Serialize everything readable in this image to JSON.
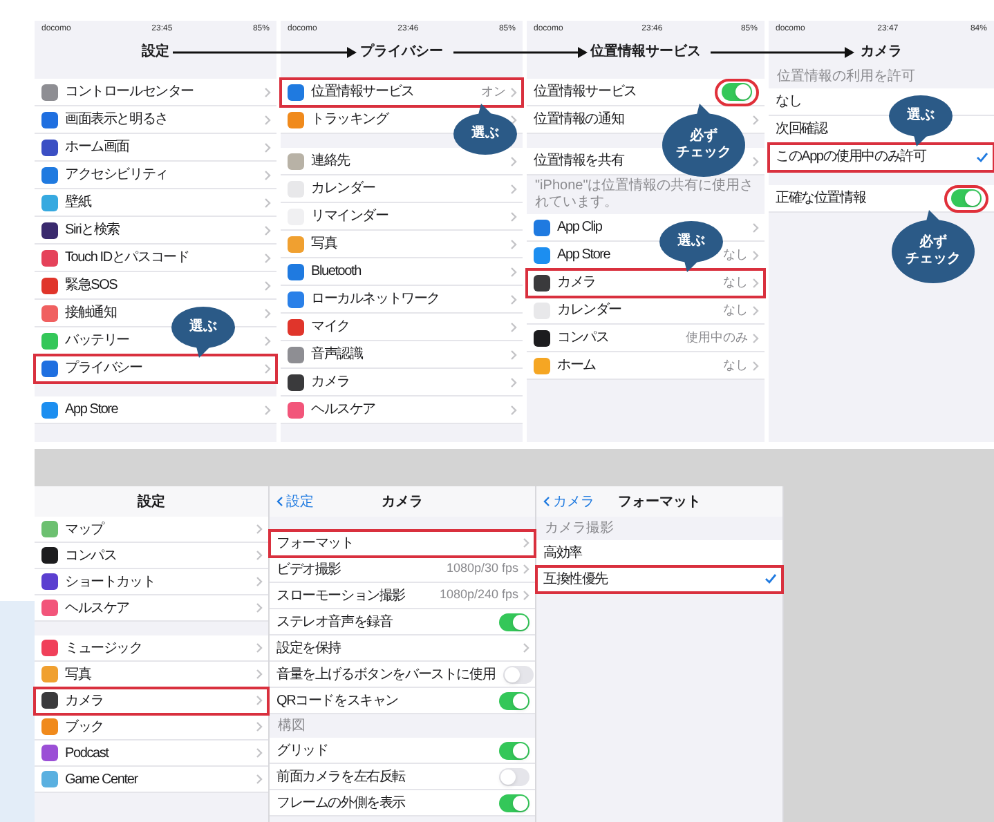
{
  "top_screens": [
    {
      "carrier": "docomo",
      "time": "23:45",
      "battery": "85%",
      "title": "設定",
      "rows": [
        {
          "kind": "gap"
        },
        {
          "kind": "nav",
          "label": "コントロールセンター",
          "color": "#8e8e93"
        },
        {
          "kind": "nav",
          "label": "画面表示と明るさ",
          "color": "#1f6fe0"
        },
        {
          "kind": "nav",
          "label": "ホーム画面",
          "color": "#3b4fc4"
        },
        {
          "kind": "nav",
          "label": "アクセシビリティ",
          "color": "#1f7ae0"
        },
        {
          "kind": "nav",
          "label": "壁紙",
          "color": "#36a9e0"
        },
        {
          "kind": "nav",
          "label": "Siriと検索",
          "color": "#3a2a6e"
        },
        {
          "kind": "nav",
          "label": "Touch IDとパスコード",
          "color": "#e5425a"
        },
        {
          "kind": "nav",
          "label": "緊急SOS",
          "color": "#e0352b"
        },
        {
          "kind": "nav",
          "label": "接触通知",
          "color": "#f06060"
        },
        {
          "kind": "nav",
          "label": "バッテリー",
          "color": "#34c759"
        },
        {
          "kind": "nav",
          "label": "プライバシー",
          "color": "#1f6fe0",
          "highlighted": true,
          "callout": {
            "lines": [
              "選ぶ"
            ]
          }
        },
        {
          "kind": "gap"
        },
        {
          "kind": "nav",
          "label": "App Store",
          "color": "#1c8ef0"
        }
      ]
    },
    {
      "carrier": "docomo",
      "time": "23:46",
      "battery": "85%",
      "title": "プライバシー",
      "rows": [
        {
          "kind": "gap"
        },
        {
          "kind": "nav",
          "label": "位置情報サービス",
          "value": "オン",
          "color": "#1f7ae0",
          "highlighted": true,
          "callout": {
            "lines": [
              "選ぶ"
            ]
          }
        },
        {
          "kind": "nav",
          "label": "トラッキング",
          "color": "#f08a1c"
        },
        {
          "kind": "gap"
        },
        {
          "kind": "nav",
          "label": "連絡先",
          "color": "#b8b2a6"
        },
        {
          "kind": "nav",
          "label": "カレンダー",
          "color": "#e8e8ea"
        },
        {
          "kind": "nav",
          "label": "リマインダー",
          "color": "#f0f0f2"
        },
        {
          "kind": "nav",
          "label": "写真",
          "color": "#f0a030"
        },
        {
          "kind": "nav",
          "label": "Bluetooth",
          "color": "#1f7ae0"
        },
        {
          "kind": "nav",
          "label": "ローカルネットワーク",
          "color": "#2a80e8"
        },
        {
          "kind": "nav",
          "label": "マイク",
          "color": "#e0352b"
        },
        {
          "kind": "nav",
          "label": "音声認識",
          "color": "#8e8e93"
        },
        {
          "kind": "nav",
          "label": "カメラ",
          "color": "#3a3a3c"
        },
        {
          "kind": "nav",
          "label": "ヘルスケア",
          "color": "#f2557a"
        }
      ]
    },
    {
      "carrier": "docomo",
      "time": "23:46",
      "battery": "85%",
      "title": "位置情報サービス",
      "rows": [
        {
          "kind": "gap"
        },
        {
          "kind": "toggle",
          "label": "位置情報サービス",
          "on": true,
          "circled": true,
          "callout": {
            "lines": [
              "必ず",
              "チェック"
            ]
          }
        },
        {
          "kind": "nav",
          "label": "位置情報の通知"
        },
        {
          "kind": "gap"
        },
        {
          "kind": "nav",
          "label": "位置情報を共有"
        },
        {
          "kind": "note",
          "text": "\"iPhone\"は位置情報の共有に使用されています。"
        },
        {
          "kind": "nav",
          "label": "App Clip",
          "color": "#1f7ae0"
        },
        {
          "kind": "nav",
          "label": "App Store",
          "value": "なし",
          "color": "#1c8ef0"
        },
        {
          "kind": "nav",
          "label": "カメラ",
          "value": "なし",
          "color": "#3a3a3c",
          "highlighted": true,
          "callout": {
            "lines": [
              "選ぶ"
            ]
          }
        },
        {
          "kind": "nav",
          "label": "カレンダー",
          "value": "なし",
          "color": "#e8e8ea"
        },
        {
          "kind": "nav",
          "label": "コンパス",
          "value": "使用中のみ",
          "color": "#1c1c1e"
        },
        {
          "kind": "nav",
          "label": "ホーム",
          "value": "なし",
          "color": "#f5a623"
        }
      ]
    },
    {
      "carrier": "docomo",
      "time": "23:47",
      "battery": "84%",
      "title": "カメラ",
      "rows": [
        {
          "kind": "header",
          "text": "位置情報の利用を許可"
        },
        {
          "kind": "check",
          "label": "なし",
          "checked": false
        },
        {
          "kind": "check",
          "label": "次回確認",
          "checked": false
        },
        {
          "kind": "check",
          "label": "このAppの使用中のみ許可",
          "checked": true,
          "highlighted": true,
          "callout": {
            "lines": [
              "選ぶ"
            ]
          }
        },
        {
          "kind": "gap"
        },
        {
          "kind": "toggle",
          "label": "正確な位置情報",
          "on": true,
          "circled": true,
          "callout": {
            "lines": [
              "必ず",
              "チェック"
            ]
          }
        }
      ]
    }
  ],
  "bottom_panes": [
    {
      "title": "設定",
      "rows": [
        {
          "kind": "nav",
          "label": "マップ",
          "color": "#6cc070"
        },
        {
          "kind": "nav",
          "label": "コンパス",
          "color": "#1c1c1e"
        },
        {
          "kind": "nav",
          "label": "ショートカット",
          "color": "#5b3fd0"
        },
        {
          "kind": "nav",
          "label": "ヘルスケア",
          "color": "#f2557a"
        },
        {
          "kind": "gap"
        },
        {
          "kind": "nav",
          "label": "ミュージック",
          "color": "#f0405a"
        },
        {
          "kind": "nav",
          "label": "写真",
          "color": "#f0a030"
        },
        {
          "kind": "nav",
          "label": "カメラ",
          "color": "#3a3a3c",
          "highlighted": true
        },
        {
          "kind": "nav",
          "label": "ブック",
          "color": "#f08a1c"
        },
        {
          "kind": "nav",
          "label": "Podcast",
          "color": "#9b4fd6"
        },
        {
          "kind": "nav",
          "label": "Game Center",
          "color": "#5ab0e0"
        }
      ]
    },
    {
      "back": "設定",
      "title": "カメラ",
      "rows": [
        {
          "kind": "gap"
        },
        {
          "kind": "nav",
          "label": "フォーマット",
          "highlighted": true
        },
        {
          "kind": "nav",
          "label": "ビデオ撮影",
          "value": "1080p/30 fps"
        },
        {
          "kind": "nav",
          "label": "スローモーション撮影",
          "value": "1080p/240 fps"
        },
        {
          "kind": "toggle",
          "label": "ステレオ音声を録音",
          "on": true
        },
        {
          "kind": "nav",
          "label": "設定を保持"
        },
        {
          "kind": "toggle",
          "label": "音量を上げるボタンをバーストに使用",
          "on": false
        },
        {
          "kind": "toggle",
          "label": "QRコードをスキャン",
          "on": true
        },
        {
          "kind": "header",
          "text": "構図"
        },
        {
          "kind": "toggle",
          "label": "グリッド",
          "on": true
        },
        {
          "kind": "toggle",
          "label": "前面カメラを左右反転",
          "on": false
        },
        {
          "kind": "toggle",
          "label": "フレームの外側を表示",
          "on": true
        }
      ]
    },
    {
      "back": "カメラ",
      "title": "フォーマット",
      "rows": [
        {
          "kind": "header",
          "text": "カメラ撮影"
        },
        {
          "kind": "check",
          "label": "高効率",
          "checked": false
        },
        {
          "kind": "check",
          "label": "互換性優先",
          "checked": true,
          "highlighted": true
        }
      ]
    }
  ]
}
